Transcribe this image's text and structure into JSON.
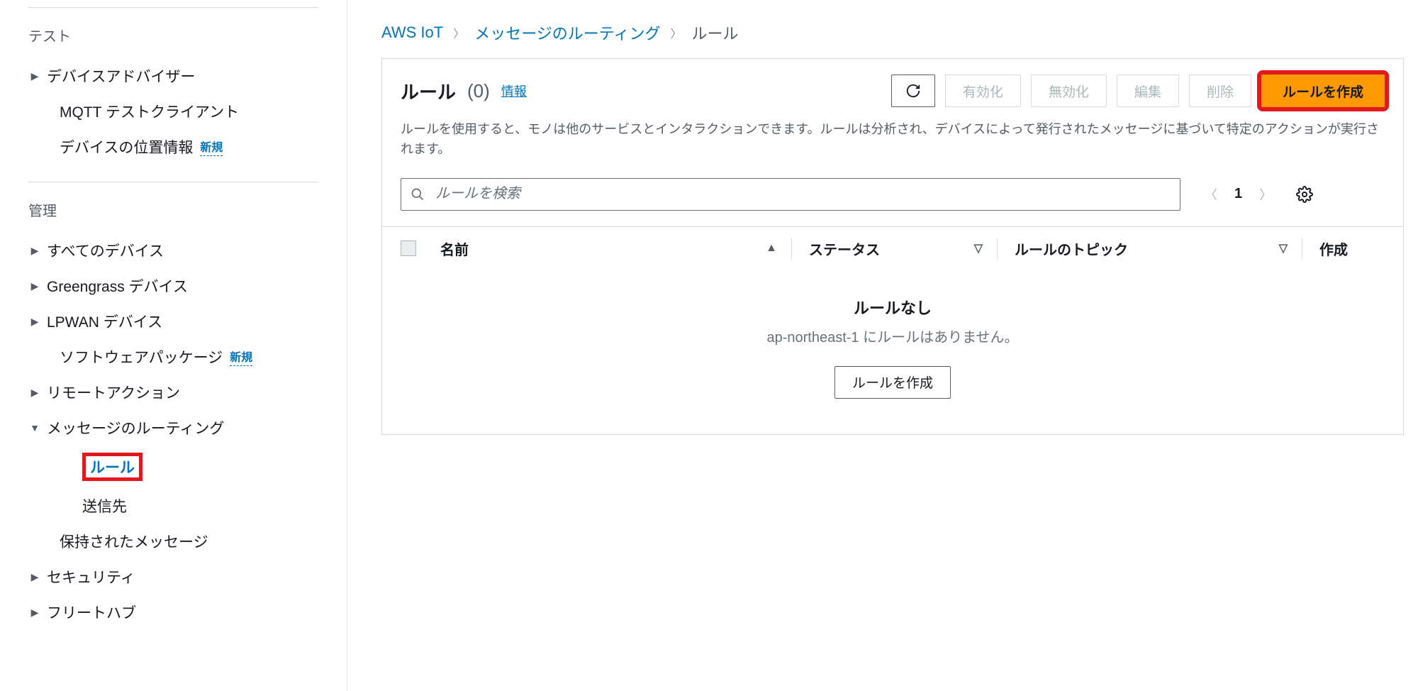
{
  "sidebar": {
    "test_header": "テスト",
    "test_items": [
      {
        "label": "デバイスアドバイザー",
        "caret": true,
        "child": false
      },
      {
        "label": "MQTT テストクライアント",
        "caret": false,
        "child": true
      },
      {
        "label": "デバイスの位置情報",
        "caret": false,
        "child": true,
        "badge": "新規"
      }
    ],
    "manage_header": "管理",
    "manage_items": [
      {
        "label": "すべてのデバイス",
        "caret": "▶"
      },
      {
        "label": "Greengrass デバイス",
        "caret": "▶"
      },
      {
        "label": "LPWAN デバイス",
        "caret": "▶"
      },
      {
        "label": "ソフトウェアパッケージ",
        "caret": "",
        "child": true,
        "badge": "新規"
      },
      {
        "label": "リモートアクション",
        "caret": "▶"
      },
      {
        "label": "メッセージのルーティング",
        "caret": "▼"
      },
      {
        "label": "ルール",
        "caret": "",
        "grandchild": true,
        "active": true,
        "redbox": true
      },
      {
        "label": "送信先",
        "caret": "",
        "grandchild": true
      },
      {
        "label": "保持されたメッセージ",
        "caret": "",
        "child": true
      },
      {
        "label": "セキュリティ",
        "caret": "▶"
      },
      {
        "label": "フリートハブ",
        "caret": "▶"
      }
    ]
  },
  "breadcrumb": {
    "a": "AWS IoT",
    "b": "メッセージのルーティング",
    "c": "ルール"
  },
  "header": {
    "title": "ルール",
    "count": "(0)",
    "info": "情報",
    "btn_enable": "有効化",
    "btn_disable": "無効化",
    "btn_edit": "編集",
    "btn_delete": "削除",
    "btn_create": "ルールを作成",
    "desc": "ルールを使用すると、モノは他のサービスとインタラクションできます。ルールは分析され、デバイスによって発行されたメッセージに基づいて特定のアクションが実行されます。"
  },
  "search": {
    "placeholder": "ルールを検索"
  },
  "pager": {
    "page": "1"
  },
  "columns": {
    "name": "名前",
    "status": "ステータス",
    "topic": "ルールのトピック",
    "created": "作成"
  },
  "empty": {
    "title": "ルールなし",
    "sub": "ap-northeast-1 にルールはありません。",
    "btn": "ルールを作成"
  }
}
